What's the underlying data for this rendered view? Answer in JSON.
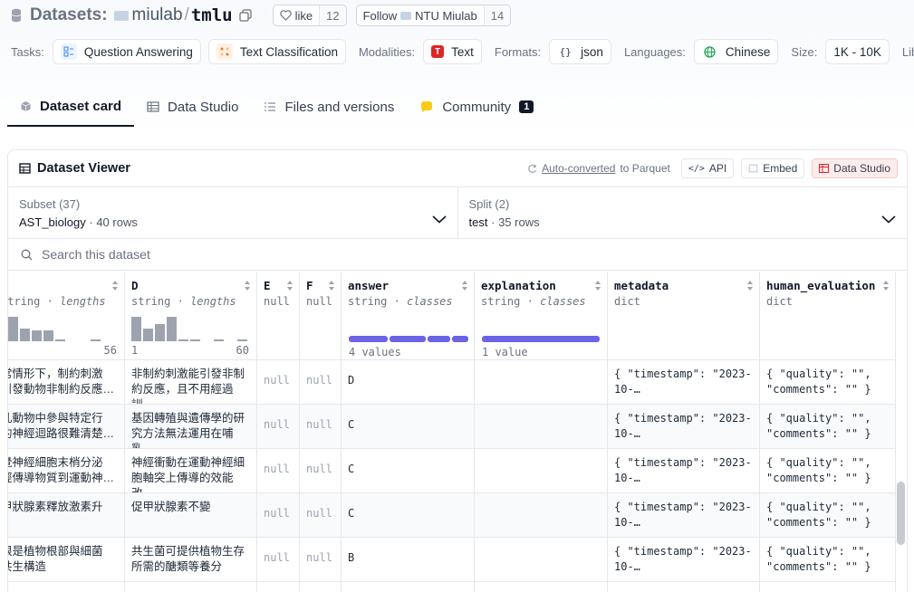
{
  "header": {
    "section": "Datasets:",
    "org": "miulab",
    "slash": "/",
    "repo": "tmlu",
    "like_label": "like",
    "like_count": "12",
    "follow_label": "Follow",
    "follow_org": "NTU Miulab",
    "follow_count": "14"
  },
  "tags": {
    "tasks_label": "Tasks:",
    "task1": "Question Answering",
    "task2": "Text Classification",
    "modalities_label": "Modalities:",
    "modality": "Text",
    "formats_label": "Formats:",
    "format": "json",
    "languages_label": "Languages:",
    "language": "Chinese",
    "size_label": "Size:",
    "size": "1K - 10K",
    "more_label": "Librar"
  },
  "tabs": {
    "dataset_card": "Dataset card",
    "data_studio": "Data Studio",
    "files": "Files and versions",
    "community": "Community",
    "community_count": "1"
  },
  "viewer": {
    "title": "Dataset Viewer",
    "auto_converted": "Auto-converted",
    "to_parquet": "to Parquet",
    "api": "API",
    "embed": "Embed",
    "data_studio": "Data Studio",
    "subset_label": "Subset (37)",
    "subset_value": "AST_biology",
    "subset_rows": "40 rows",
    "split_label": "Split (2)",
    "split_value": "test",
    "split_rows": "35 rows",
    "dot": "·",
    "search_placeholder": "Search this dataset"
  },
  "columns": {
    "c": {
      "type": "string",
      "sub": "lengths",
      "max": "56"
    },
    "d": {
      "name": "D",
      "type": "string",
      "sub": "lengths",
      "min": "1",
      "max": "60"
    },
    "e": {
      "name": "E",
      "type": "null"
    },
    "f": {
      "name": "F",
      "type": "null"
    },
    "answer": {
      "name": "answer",
      "type": "string",
      "sub": "classes",
      "summary": "4 values"
    },
    "explanation": {
      "name": "explanation",
      "type": "string",
      "sub": "classes",
      "summary": "1 value"
    },
    "metadata": {
      "name": "metadata",
      "type": "dict"
    },
    "human_evaluation": {
      "name": "human_evaluation",
      "type": "dict"
    },
    "sep": "·"
  },
  "rows": [
    {
      "c1": "常情形下，制約刺激",
      "c2": "引發動物非制約反應…",
      "d1": "非制約刺激能引發非制",
      "d2": "約反應，且不用經過訓…",
      "e": "null",
      "f": "null",
      "answer": "D",
      "m1": "{ \"timestamp\": \"2023-",
      "m2": "10-…",
      "h1": "{ \"quality\": \"\",",
      "h2": "\"comments\": \"\" }"
    },
    {
      "c1": "乳動物中參與特定行",
      "c2": "的神經迴路很難清楚…",
      "d1": "基因轉殖與遺傳學的研",
      "d2": "究方法無法運用在哺乳…",
      "e": "null",
      "f": "null",
      "answer": "C",
      "m1": "{ \"timestamp\": \"2023-",
      "m2": "10-…",
      "h1": "{ \"quality\": \"\",",
      "h2": "\"comments\": \"\" }"
    },
    {
      "c1": "覺神經細胞末梢分泌",
      "c2": "經傳導物質到運動神…",
      "d1": "神經衝動在運動神經細",
      "d2": "胞軸突上傳導的效能改…",
      "e": "null",
      "f": "null",
      "answer": "C",
      "m1": "{ \"timestamp\": \"2023-",
      "m2": "10-…",
      "h1": "{ \"quality\": \"\",",
      "h2": "\"comments\": \"\" }"
    },
    {
      "c1": "甲狀腺素釋放激素升",
      "c2": "",
      "d1": "促甲狀腺素不變",
      "d2": "",
      "e": "null",
      "f": "null",
      "answer": "C",
      "m1": "{ \"timestamp\": \"2023-",
      "m2": "10-…",
      "h1": "{ \"quality\": \"\",",
      "h2": "\"comments\": \"\" }"
    },
    {
      "c1": "根是植物根部與細菌",
      "c2": "共生構造",
      "d1": "共生菌可提供植物生存",
      "d2": "所需的醣類等養分",
      "e": "null",
      "f": "null",
      "answer": "B",
      "m1": "{ \"timestamp\": \"2023-",
      "m2": "10-…",
      "h1": "{ \"quality\": \"\",",
      "h2": "\"comments\": \"\" }"
    }
  ],
  "colors": {
    "accent_bar": "#6b63e6",
    "hist_bar": "#9ca3af"
  }
}
